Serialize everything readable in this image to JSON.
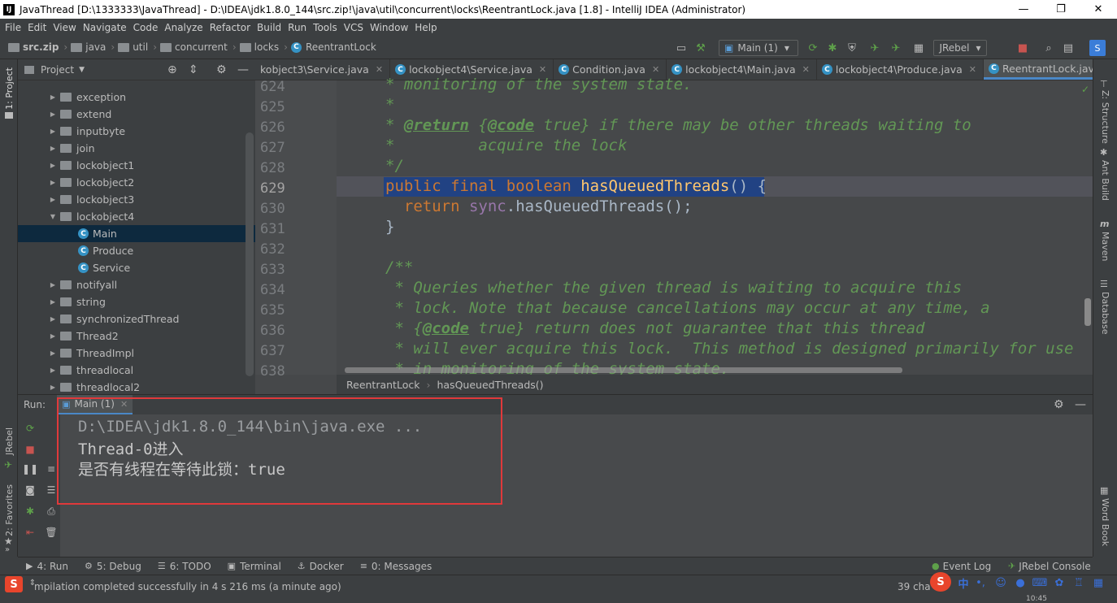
{
  "window": {
    "app_icon": "IJ",
    "title": "JavaThread [D:\\1333333\\JavaThread] - D:\\IDEA\\jdk1.8.0_144\\src.zip!\\java\\util\\concurrent\\locks\\ReentrantLock.java [1.8] - IntelliJ IDEA (Administrator)",
    "minimize": "—",
    "maximize": "❐",
    "close": "✕"
  },
  "menu": [
    "File",
    "Edit",
    "View",
    "Navigate",
    "Code",
    "Analyze",
    "Refactor",
    "Build",
    "Run",
    "Tools",
    "VCS",
    "Window",
    "Help"
  ],
  "breadcrumb": [
    "src.zip",
    "java",
    "util",
    "concurrent",
    "locks",
    "ReentrantLock"
  ],
  "toolbar": {
    "run_config": "Main (1)",
    "jrebel": "JRebel"
  },
  "left_strip": {
    "project_tab": "1: Project",
    "jrebel_tab": "JRebel",
    "favorites_tab": "2: Favorites"
  },
  "right_strip": {
    "structure": "Z: Structure",
    "ant": "Ant Build",
    "maven": "Maven",
    "database": "Database",
    "wordbook": "Word Book"
  },
  "project": {
    "header": "Project",
    "items": [
      {
        "label": "exception",
        "type": "folder",
        "open": false,
        "depth": 1
      },
      {
        "label": "extend",
        "type": "folder",
        "open": false,
        "depth": 1
      },
      {
        "label": "inputbyte",
        "type": "folder",
        "open": false,
        "depth": 1
      },
      {
        "label": "join",
        "type": "folder",
        "open": false,
        "depth": 1
      },
      {
        "label": "lockobject1",
        "type": "folder",
        "open": false,
        "depth": 1
      },
      {
        "label": "lockobject2",
        "type": "folder",
        "open": false,
        "depth": 1
      },
      {
        "label": "lockobject3",
        "type": "folder",
        "open": false,
        "depth": 1
      },
      {
        "label": "lockobject4",
        "type": "folder",
        "open": true,
        "depth": 1
      },
      {
        "label": "Main",
        "type": "class",
        "depth": 2,
        "selected": true
      },
      {
        "label": "Produce",
        "type": "class",
        "depth": 2
      },
      {
        "label": "Service",
        "type": "class",
        "depth": 2
      },
      {
        "label": "notifyall",
        "type": "folder",
        "open": false,
        "depth": 1
      },
      {
        "label": "string",
        "type": "folder",
        "open": false,
        "depth": 1
      },
      {
        "label": "synchronizedThread",
        "type": "folder",
        "open": false,
        "depth": 1
      },
      {
        "label": "Thread2",
        "type": "folder",
        "open": false,
        "depth": 1
      },
      {
        "label": "ThreadImpl",
        "type": "folder",
        "open": false,
        "depth": 1
      },
      {
        "label": "threadlocal",
        "type": "folder",
        "open": false,
        "depth": 1
      },
      {
        "label": "threadlocal2",
        "type": "folder",
        "open": false,
        "depth": 1
      }
    ]
  },
  "editor_tabs": [
    {
      "label": "kobject3\\Service.java",
      "icon": false
    },
    {
      "label": "lockobject4\\Service.java",
      "icon": true
    },
    {
      "label": "Condition.java",
      "icon": true
    },
    {
      "label": "lockobject4\\Main.java",
      "icon": true
    },
    {
      "label": "lockobject4\\Produce.java",
      "icon": true
    },
    {
      "label": "ReentrantLock.java",
      "icon": true,
      "active": true
    }
  ],
  "editor_tab_overflow": "≡¹",
  "code": {
    "lines": [
      {
        "num": "624",
        "text": "* monitoring of the system state."
      },
      {
        "num": "625",
        "text": "*"
      },
      {
        "num": "626",
        "text_a": "* ",
        "tag": "@return",
        "text_b": " {",
        "tag2": "@code",
        "text_c": " true} if there may be other threads waiting to"
      },
      {
        "num": "627",
        "text": "*         acquire the lock"
      },
      {
        "num": "628",
        "text": "*/"
      },
      {
        "num": "629",
        "kw1": "public final boolean",
        "fn": "hasQueuedThreads",
        "rest": "() {"
      },
      {
        "num": "630",
        "kw1": "return",
        "fld": "sync",
        "rest": ".hasQueuedThreads();"
      },
      {
        "num": "631",
        "rest": "}"
      },
      {
        "num": "632",
        "text": ""
      },
      {
        "num": "633",
        "text": "/**"
      },
      {
        "num": "634",
        "text": " * Queries whether the given thread is waiting to acquire this"
      },
      {
        "num": "635",
        "text": " * lock. Note that because cancellations may occur at any time, a"
      },
      {
        "num": "636",
        "text_a": " * {",
        "tag": "@code",
        "text_b": " true} return does not guarantee that this thread"
      },
      {
        "num": "637",
        "text": " * will ever acquire this lock.  This method is designed primarily for use"
      },
      {
        "num": "638",
        "text": " * in monitoring of the system state."
      }
    ],
    "breadcrumb_class": "ReentrantLock",
    "breadcrumb_method": "hasQueuedThreads()"
  },
  "run": {
    "label": "Run:",
    "tab": "Main (1)",
    "console": [
      "D:\\IDEA\\jdk1.8.0_144\\bin\\java.exe ...",
      "Thread-0进入",
      "是否有线程在等待此锁：true"
    ]
  },
  "bottom_tabs": [
    {
      "label": "4: Run",
      "icon": "▶"
    },
    {
      "label": "5: Debug",
      "icon": "⚙"
    },
    {
      "label": "6: TODO",
      "icon": "☰"
    },
    {
      "label": "Terminal",
      "icon": "▣"
    },
    {
      "label": "Docker",
      "icon": "⚓"
    },
    {
      "label": "0: Messages",
      "icon": "≡"
    }
  ],
  "bottom_right": {
    "event_log": "Event Log",
    "jrebel_console": "JRebel Console"
  },
  "status": {
    "message": "mpilation completed successfully in 4 s 216 ms (a minute ago)",
    "chars": "39 cha",
    "time": "10:45"
  },
  "tray": {
    "ime_logo": "S",
    "ime_lang": "中"
  },
  "colors": {
    "accent": "#4a88c7",
    "comment": "#629755",
    "keyword": "#cc7832",
    "function": "#ffc66d",
    "highlight_box": "#e0393b"
  }
}
